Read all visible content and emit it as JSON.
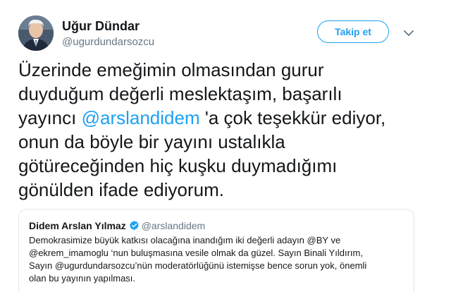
{
  "author": {
    "name": "Uğur Dündar",
    "handle": "@ugurdundarsozcu",
    "avatar_icon": "profile-photo"
  },
  "follow_button": {
    "label": "Takip et"
  },
  "menu": {
    "icon": "chevron-down-icon"
  },
  "tweet": {
    "lines": [
      "Üzerinde emeğimin olmasından gurur",
      "duyduğum değerli meslektaşım, başarılı",
      "yayıncı ",
      "onun da böyle bir yayını ustalıkla",
      "götüreceğinden hiç kuşku duymadığımı",
      "gönülden ifade ediyorum."
    ],
    "mention": "@arslandidem",
    "after_mention": " 'a çok teşekkür ediyor,"
  },
  "quoted": {
    "name": "Didem Arslan Yılmaz",
    "verified_icon": "verified-badge-icon",
    "handle": "@arslandidem",
    "lines": [
      "Demokrasimize büyük katkısı olacağına inandığım iki değerli adayın @BY ve",
      "@ekrem_imamoglu ‘nun buluşmasına vesile olmak da güzel. Sayın Binali Yıldırım,",
      "Sayın @ugurdundarsozcu’nün moderatörlüğünü istemişse bence sorun yok, önemli",
      "olan bu yayının yapılması."
    ]
  },
  "colors": {
    "accent": "#1da1f2",
    "text": "#14171a",
    "secondary": "#657786",
    "border": "#e1e8ed"
  }
}
